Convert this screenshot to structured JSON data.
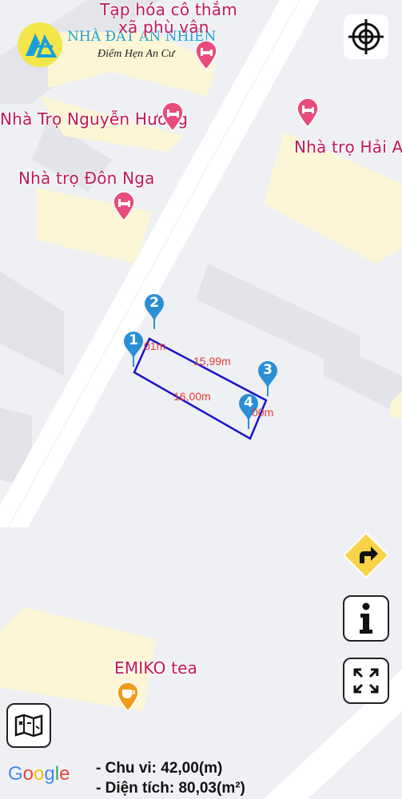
{
  "logo": {
    "title": "NHÀ ĐẤT AN NHIÊN",
    "subtitle": "Điểm Hẹn An Cư"
  },
  "places": [
    {
      "line1": "Tạp hóa cô thắm",
      "line2": "xã phù vân",
      "type": "lodging"
    },
    {
      "name": "Nhà Trọ Nguyễn Hương",
      "type": "lodging"
    },
    {
      "name": "Nhà trọ Hải Anh",
      "type": "lodging"
    },
    {
      "name": "Nhà trọ Đôn Nga",
      "type": "lodging"
    },
    {
      "name": "EMIKO tea",
      "type": "cafe"
    }
  ],
  "plot": {
    "markers": [
      "1",
      "2",
      "3",
      "4"
    ],
    "edges": {
      "top": "15,99m",
      "bottom": "16,00m",
      "left_partial": "01m",
      "right_partial": "00m"
    }
  },
  "summary": {
    "perimeter": "- Chu vi: 42,00(m)",
    "area": "- Diện tích: 80,03(m²)"
  },
  "controls": {
    "locate": "crosshair-icon",
    "directions": "turn-right-icon",
    "info": "info-icon",
    "fullscreen": "fullscreen-icon",
    "map_layers": "folded-map-icon"
  },
  "attribution": "Google",
  "colors": {
    "road": "#ffffff",
    "building": "#fdf6d6",
    "poi": "#e84c7d",
    "plot_outline": "#1a13c8",
    "marker": "#2b8fd6",
    "dimension_text": "#e53935",
    "directions_bg": "#f8d34a"
  }
}
